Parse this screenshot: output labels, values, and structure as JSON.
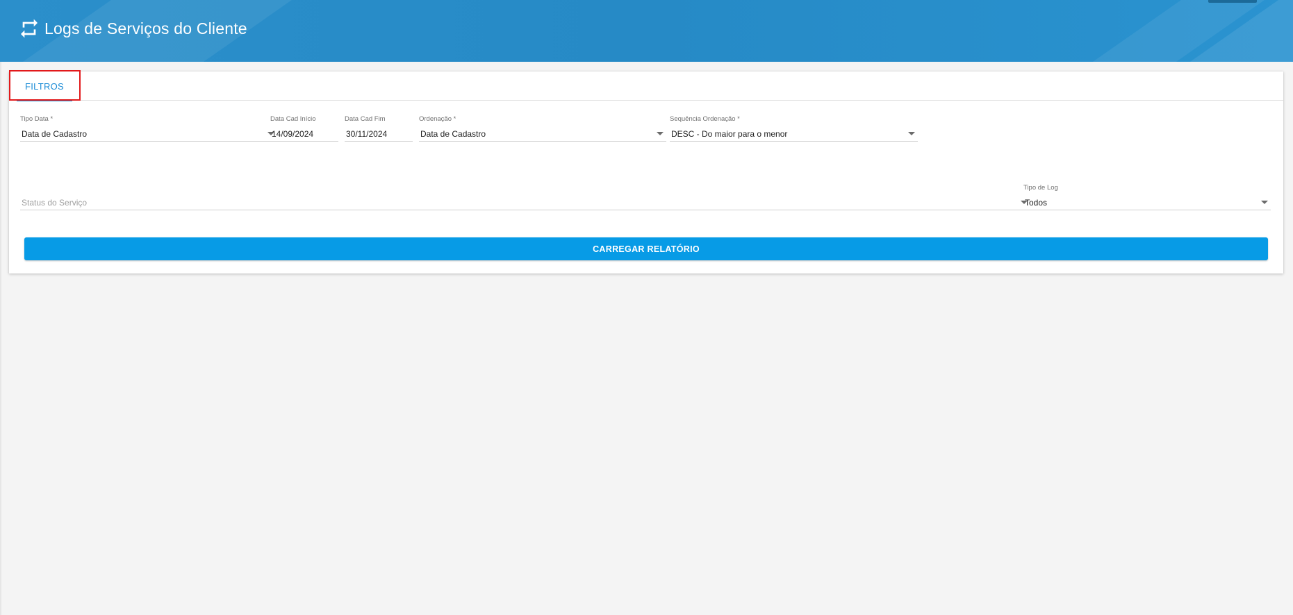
{
  "header": {
    "title": "Logs de Serviços do Cliente",
    "icon": "repeat-icon"
  },
  "tabs": [
    {
      "label": "FILTROS",
      "active": true
    }
  ],
  "filters": {
    "tipo_data": {
      "label": "Tipo Data *",
      "value": "Data de Cadastro"
    },
    "data_inicio": {
      "label": "Data Cad Início",
      "value": "14/09/2024"
    },
    "data_fim": {
      "label": "Data Cad Fim",
      "value": "30/11/2024"
    },
    "ordenacao": {
      "label": "Ordenação *",
      "value": "Data de Cadastro"
    },
    "sequencia": {
      "label": "Sequência Ordenação *",
      "value": "DESC - Do maior para o menor"
    },
    "status_servico": {
      "placeholder": "Status do Serviço"
    },
    "tipo_log": {
      "label": "Tipo de Log",
      "value": "Todos"
    }
  },
  "actions": {
    "load_report": "CARREGAR RELATÓRIO"
  },
  "colors": {
    "header": "#268ac6",
    "accent": "#1a8bd6",
    "button": "#079be6",
    "highlight": "#e2191b"
  }
}
